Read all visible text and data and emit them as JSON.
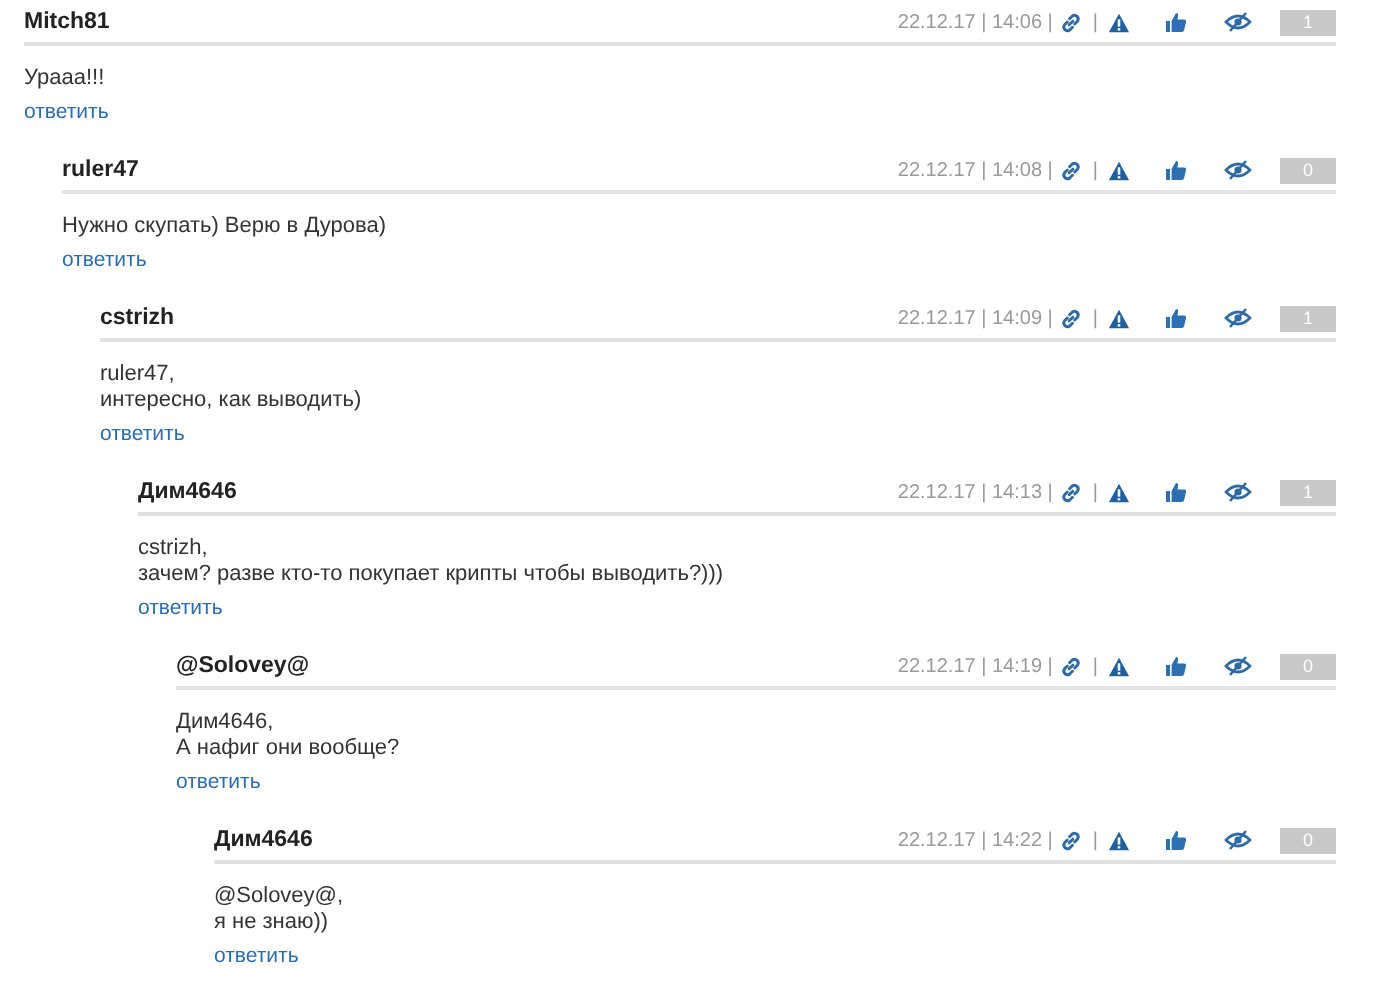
{
  "comments": [
    {
      "author": "Mitch81",
      "date": "22.12.17 | 14:06 |",
      "sep": "|",
      "score": "1",
      "lines": [
        "Урааа!!!"
      ],
      "reply": "ответить",
      "children": [
        {
          "author": "ruler47",
          "date": "22.12.17 | 14:08 |",
          "sep": "|",
          "score": "0",
          "lines": [
            "Нужно скупать) Верю в Дурова)"
          ],
          "reply": "ответить",
          "children": [
            {
              "author": "cstrizh",
              "date": "22.12.17 | 14:09 |",
              "sep": "|",
              "score": "1",
              "lines": [
                "ruler47,",
                "интересно, как выводить)"
              ],
              "reply": "ответить",
              "children": [
                {
                  "author": "Дим4646",
                  "date": "22.12.17 | 14:13 |",
                  "sep": "|",
                  "score": "1",
                  "lines": [
                    "cstrizh,",
                    "зачем? разве кто-то покупает крипты чтобы выводить?)))"
                  ],
                  "reply": "ответить",
                  "children": [
                    {
                      "author": "@Solovey@",
                      "date": "22.12.17 | 14:19 |",
                      "sep": "|",
                      "score": "0",
                      "lines": [
                        "Дим4646,",
                        "А нафиг они вообще?"
                      ],
                      "reply": "ответить",
                      "children": [
                        {
                          "author": "Дим4646",
                          "date": "22.12.17 | 14:22 |",
                          "sep": "|",
                          "score": "0",
                          "lines": [
                            "@Solovey@,",
                            "я не знаю))"
                          ],
                          "reply": "ответить"
                        }
                      ]
                    }
                  ]
                }
              ]
            }
          ]
        }
      ]
    }
  ]
}
